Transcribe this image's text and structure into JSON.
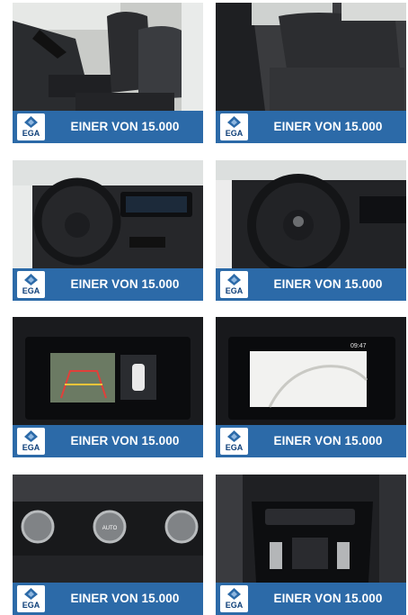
{
  "gallery": {
    "tiles": [
      {
        "id": "front-seats",
        "banner_text": "EINER VON 15.000",
        "logo_text": "EGA"
      },
      {
        "id": "rear-seats",
        "banner_text": "EINER VON 15.000",
        "logo_text": "EGA"
      },
      {
        "id": "steering-wheel-wide",
        "banner_text": "EINER VON 15.000",
        "logo_text": "EGA"
      },
      {
        "id": "steering-wheel-close",
        "banner_text": "EINER VON 15.000",
        "logo_text": "EGA"
      },
      {
        "id": "rear-camera-screen",
        "banner_text": "EINER VON 15.000",
        "logo_text": "EGA"
      },
      {
        "id": "navigation-screen",
        "banner_text": "EINER VON 15.000",
        "logo_text": "EGA",
        "screen_time": "09:47"
      },
      {
        "id": "climate-controls",
        "banner_text": "EINER VON 15.000",
        "logo_text": "EGA",
        "knob_label": "AUTO"
      },
      {
        "id": "center-console",
        "banner_text": "EINER VON 15.000",
        "logo_text": "EGA"
      }
    ]
  },
  "colors": {
    "banner": "#2c6aa8",
    "logo_bg": "#ffffff",
    "logo_text": "#0b3d78"
  }
}
